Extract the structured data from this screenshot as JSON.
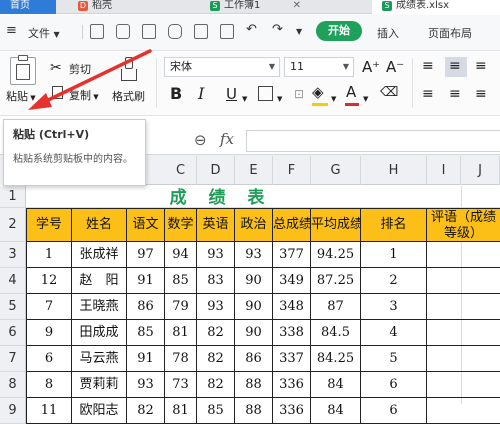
{
  "tabs": [
    {
      "label": "首页"
    },
    {
      "label": "稻壳"
    },
    {
      "label": "工作簿1"
    },
    {
      "label": "成绩表.xlsx"
    }
  ],
  "menu": {
    "file": "文件",
    "start": "开始",
    "insert": "插入",
    "page_layout": "页面布局"
  },
  "ribbon": {
    "paste": "粘贴",
    "cut": "剪切",
    "copy": "复制",
    "format_painter": "格式刷",
    "font_name": "宋体",
    "font_size": "11"
  },
  "tooltip": {
    "title": "粘贴 (Ctrl+V)",
    "description": "粘贴系统剪贴板中的内容。"
  },
  "formula_bar": {
    "fx": "fx"
  },
  "columns": [
    "C",
    "D",
    "E",
    "F",
    "G",
    "H",
    "I",
    "J"
  ],
  "sheet": {
    "title": "成 绩 表",
    "headers": [
      "学号",
      "姓名",
      "语文",
      "数学",
      "英语",
      "政治",
      "总成绩",
      "平均成绩",
      "排名",
      "评语（成绩等级）"
    ],
    "rows": [
      {
        "row": "3",
        "cells": [
          "1",
          "张成祥",
          "97",
          "94",
          "93",
          "93",
          "377",
          "94.25",
          "1",
          ""
        ]
      },
      {
        "row": "4",
        "cells": [
          "12",
          "赵　阳",
          "91",
          "85",
          "83",
          "90",
          "349",
          "87.25",
          "2",
          ""
        ]
      },
      {
        "row": "5",
        "cells": [
          "7",
          "王晓燕",
          "86",
          "79",
          "93",
          "90",
          "348",
          "87",
          "3",
          ""
        ]
      },
      {
        "row": "6",
        "cells": [
          "9",
          "田成成",
          "85",
          "81",
          "82",
          "90",
          "338",
          "84.5",
          "4",
          ""
        ]
      },
      {
        "row": "7",
        "cells": [
          "6",
          "马云燕",
          "91",
          "78",
          "82",
          "86",
          "337",
          "84.25",
          "5",
          ""
        ]
      },
      {
        "row": "8",
        "cells": [
          "8",
          "贾莉莉",
          "93",
          "73",
          "82",
          "88",
          "336",
          "84",
          "6",
          ""
        ]
      },
      {
        "row": "9",
        "cells": [
          "11",
          "欧阳志",
          "82",
          "81",
          "85",
          "88",
          "336",
          "84",
          "6",
          ""
        ]
      }
    ]
  },
  "colors": {
    "accent": "#1fa05b",
    "header_fill": "#fbbf17",
    "title_green": "#1e9d57",
    "arrow_red": "#e5322d"
  }
}
